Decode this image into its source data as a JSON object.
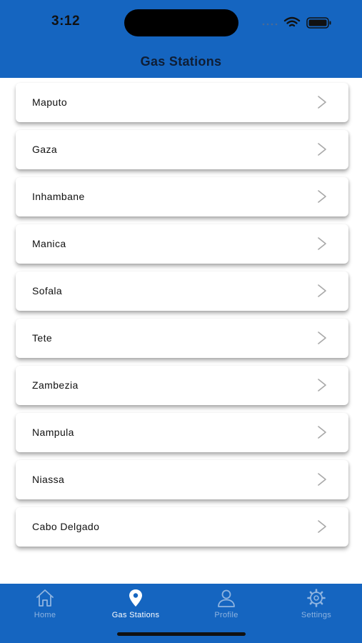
{
  "status_bar": {
    "time": "3:12"
  },
  "header": {
    "title": "Gas Stations"
  },
  "provinces": [
    "Maputo",
    "Gaza",
    "Inhambane",
    "Manica",
    "Sofala",
    "Tete",
    "Zambezia",
    "Nampula",
    "Niassa",
    "Cabo Delgado"
  ],
  "tabbar": {
    "tabs": [
      {
        "label": "Home",
        "icon": "home-icon",
        "active": false
      },
      {
        "label": "Gas Stations",
        "icon": "location-pin-icon",
        "active": true
      },
      {
        "label": "Profile",
        "icon": "person-icon",
        "active": false
      },
      {
        "label": "Settings",
        "icon": "gear-icon",
        "active": false
      }
    ]
  },
  "colors": {
    "primary": "#1565c0",
    "tab_active": "#ffffff",
    "tab_inactive": "#8fb4e0"
  }
}
